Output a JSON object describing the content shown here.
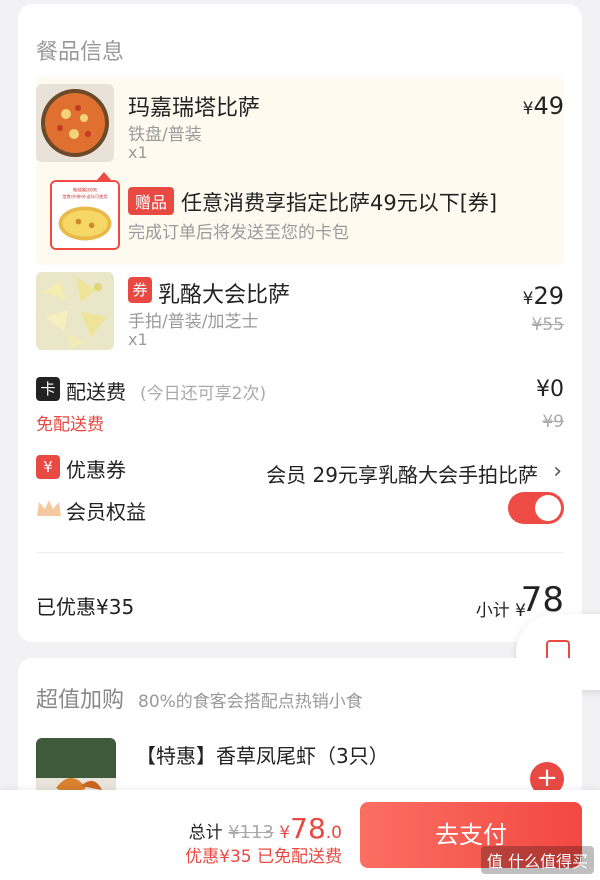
{
  "order": {
    "section_title": "餐品信息",
    "items": [
      {
        "name": "玛嘉瑞塔比萨",
        "spec": "铁盘/普装",
        "qty": "x1",
        "price": "49",
        "currency": "¥"
      },
      {
        "name": "乳酪大会比萨",
        "spec": "手拍/普装/加芝士",
        "qty": "x1",
        "price": "29",
        "currency": "¥",
        "original_price": "¥55",
        "tag": "券"
      }
    ],
    "gift": {
      "tag": "赠品",
      "title": "任意消费享指定比萨49元以下[券]",
      "subtitle": "完成订单后将发送至您的卡包",
      "thumb_caption": "有效期30天\n堂食/外带/外送均可使用"
    },
    "delivery": {
      "icon_label": "卡",
      "label": "配送费",
      "note": "(今日还可享2次)",
      "free_label": "免配送费",
      "price": "¥0",
      "original_price": "¥9"
    },
    "coupon": {
      "icon_label": "¥",
      "label": "优惠券",
      "value": "会员 29元享乳酪大会手拍比萨",
      "chevron": "›"
    },
    "membership": {
      "label": "会员权益",
      "enabled": true
    },
    "summary": {
      "saved": "已优惠¥35",
      "subtotal_label": "小计 ¥",
      "subtotal_value": "78"
    }
  },
  "addon": {
    "title": "超值加购",
    "subtitle": "80%的食客会搭配点热销小食",
    "item_name": "【特惠】香草凤尾虾（3只）",
    "add_symbol": "+"
  },
  "footer": {
    "total_label": "总计",
    "original_total": "¥113",
    "currency": "¥",
    "total_int": "78",
    "total_dec": ".0",
    "discount_line": "优惠¥35 已免配送费",
    "pay_button": "去支付",
    "watermark": "值 什么值得买"
  },
  "colors": {
    "accent": "#e84a43",
    "highlight_bg": "#fffaf0",
    "page_bg": "#f2f2f5"
  }
}
